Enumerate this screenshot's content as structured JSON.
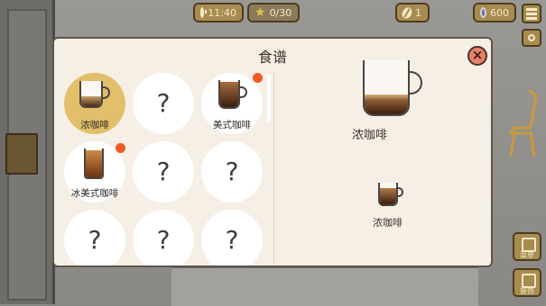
{
  "hud": {
    "clock": "11:40",
    "stars": "0/30",
    "beans": "1",
    "coins": "600"
  },
  "side_buttons": {
    "btn1_label": "菜单",
    "btn2_label": "装饰"
  },
  "dialog": {
    "title": "食谱",
    "close_label": "×"
  },
  "recipes": [
    {
      "name": "浓咖啡",
      "unlocked": true,
      "selected": true,
      "new": false
    },
    {
      "name": "?",
      "unlocked": false
    },
    {
      "name": "美式咖啡",
      "unlocked": true,
      "selected": false,
      "new": true
    },
    {
      "name": "冰美式咖啡",
      "unlocked": true,
      "selected": false,
      "new": true
    },
    {
      "name": "?",
      "unlocked": false
    },
    {
      "name": "?",
      "unlocked": false
    },
    {
      "name": "?",
      "unlocked": false
    },
    {
      "name": "?",
      "unlocked": false
    },
    {
      "name": "?",
      "unlocked": false
    }
  ],
  "detail": {
    "name": "浓咖啡",
    "ingredient": "浓咖啡"
  },
  "colors": {
    "accent_gold": "#a88b4f",
    "selected_slot": "#e2bf6a",
    "new_dot": "#f15a22",
    "close_red": "#e8816a"
  }
}
